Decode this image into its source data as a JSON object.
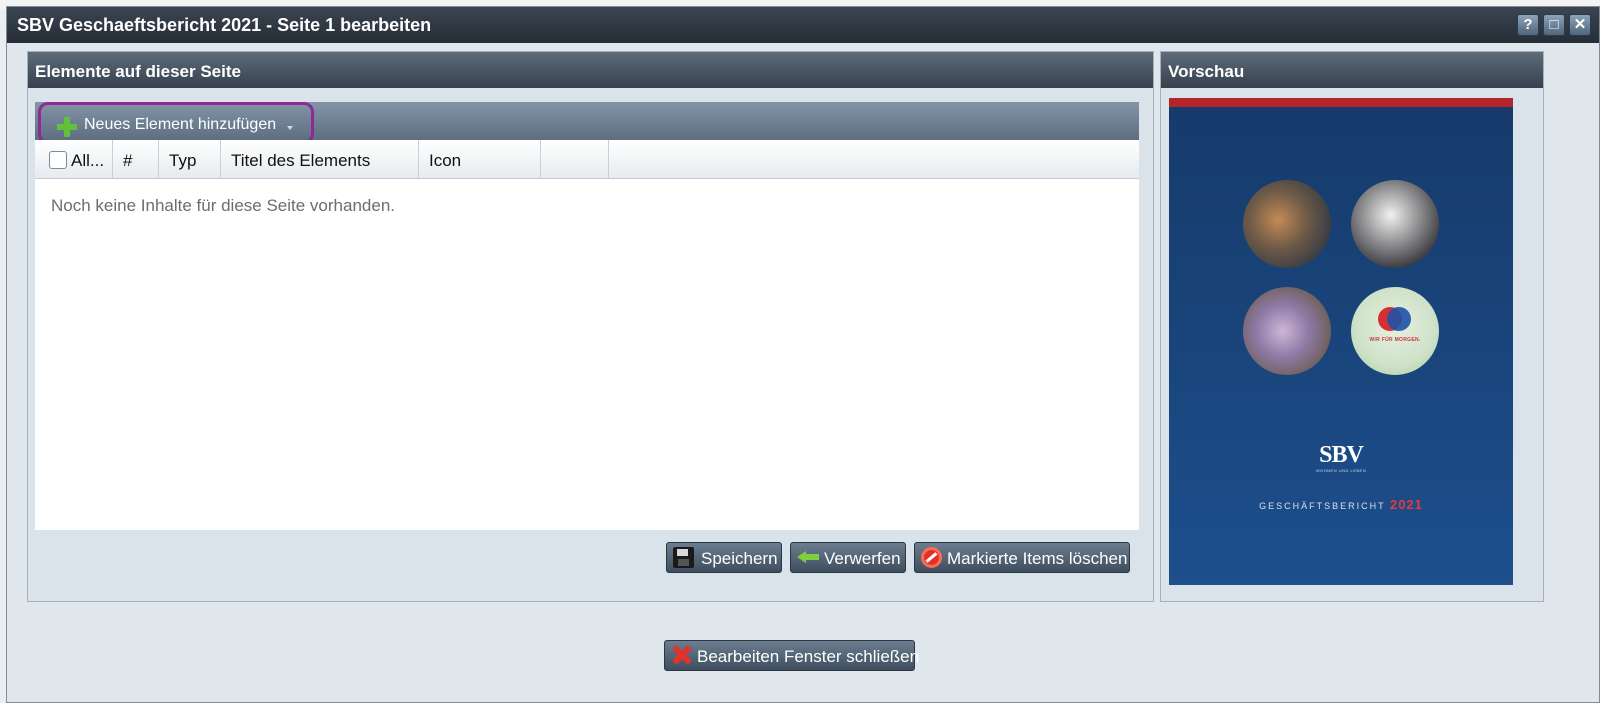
{
  "window": {
    "title": "SBV Geschaeftsbericht 2021 - Seite 1 bearbeiten",
    "help_icon": "?",
    "close_glyph": "✕"
  },
  "elements_panel": {
    "title": "Elemente auf dieser Seite",
    "add_button_label": "Neues Element hinzufügen",
    "columns": [
      "All...",
      "#",
      "Typ",
      "Titel des Elements",
      "Icon",
      ""
    ],
    "empty_message": "Noch keine Inhalte für diese Seite vorhanden.",
    "buttons": {
      "save": "Speichern",
      "discard": "Verwerfen",
      "delete_marked": "Markierte Items löschen"
    }
  },
  "preview_panel": {
    "title": "Vorschau",
    "cover": {
      "badge_text": "WIR FÜR MORGEN.",
      "logo_text": "SBV",
      "logo_tagline": "WOHNEN UND LEBEN",
      "report_label": "GESCHÄFTSBERICHT",
      "report_year": "2021"
    }
  },
  "footer": {
    "close_button_label": "Bearbeiten Fenster schließen"
  },
  "colors": {
    "titlebar": "#2b343e",
    "panel_header": "#4a5664",
    "highlight_outline": "#8e2a96",
    "cover_blue": "#1b4680",
    "cover_red": "#b4252a"
  }
}
